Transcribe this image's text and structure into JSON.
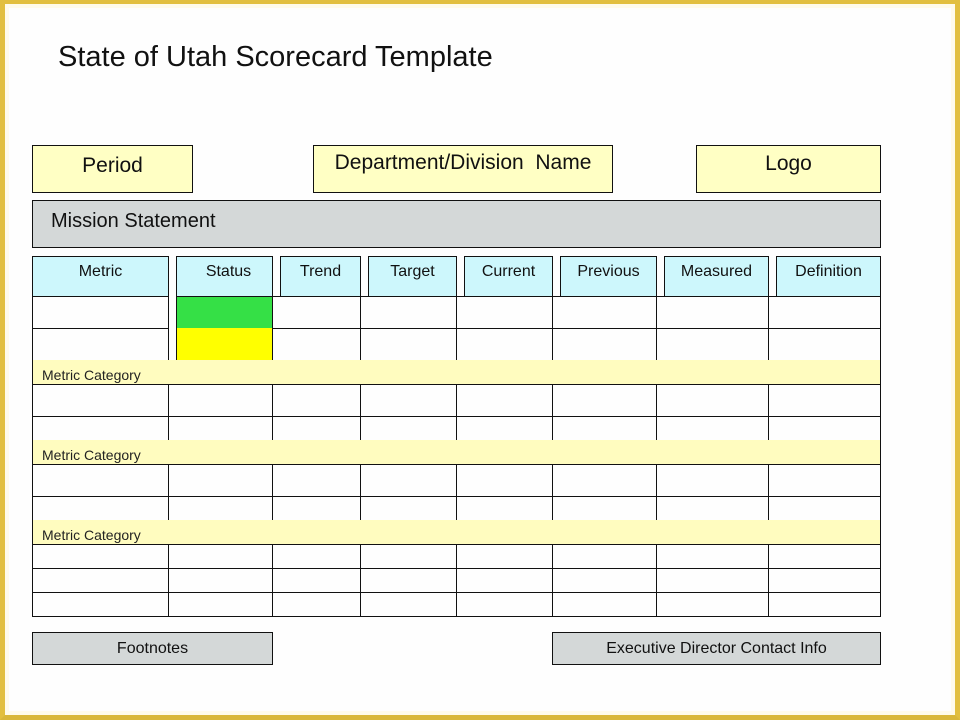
{
  "title": "State of Utah Scorecard Template",
  "header": {
    "period": "Period",
    "department": "Department/Division  Name",
    "logo": "Logo"
  },
  "mission": "Mission Statement",
  "table": {
    "columns": [
      "Metric",
      "Status",
      "Trend",
      "Target",
      "Current",
      "Previous",
      "Measured",
      "Definition"
    ],
    "status_colors": {
      "green": "#35e046",
      "yellow": "#ffff00"
    },
    "sections": [
      {
        "category": null,
        "rows": 2,
        "status": [
          "green",
          "yellow"
        ]
      },
      {
        "category": "Metric Category",
        "rows": 2,
        "status": []
      },
      {
        "category": "Metric Category",
        "rows": 2,
        "status": []
      },
      {
        "category": "Metric Category",
        "rows": 3,
        "status": []
      }
    ]
  },
  "footer": {
    "footnotes": "Footnotes",
    "contact": "Executive Director Contact Info"
  },
  "colors": {
    "frame": "#e2bf3f",
    "header_fill": "#ffffc4",
    "mission_fill": "#d4d8d8",
    "column_header_fill": "#cdf7fc",
    "category_fill": "#fffcbf"
  }
}
